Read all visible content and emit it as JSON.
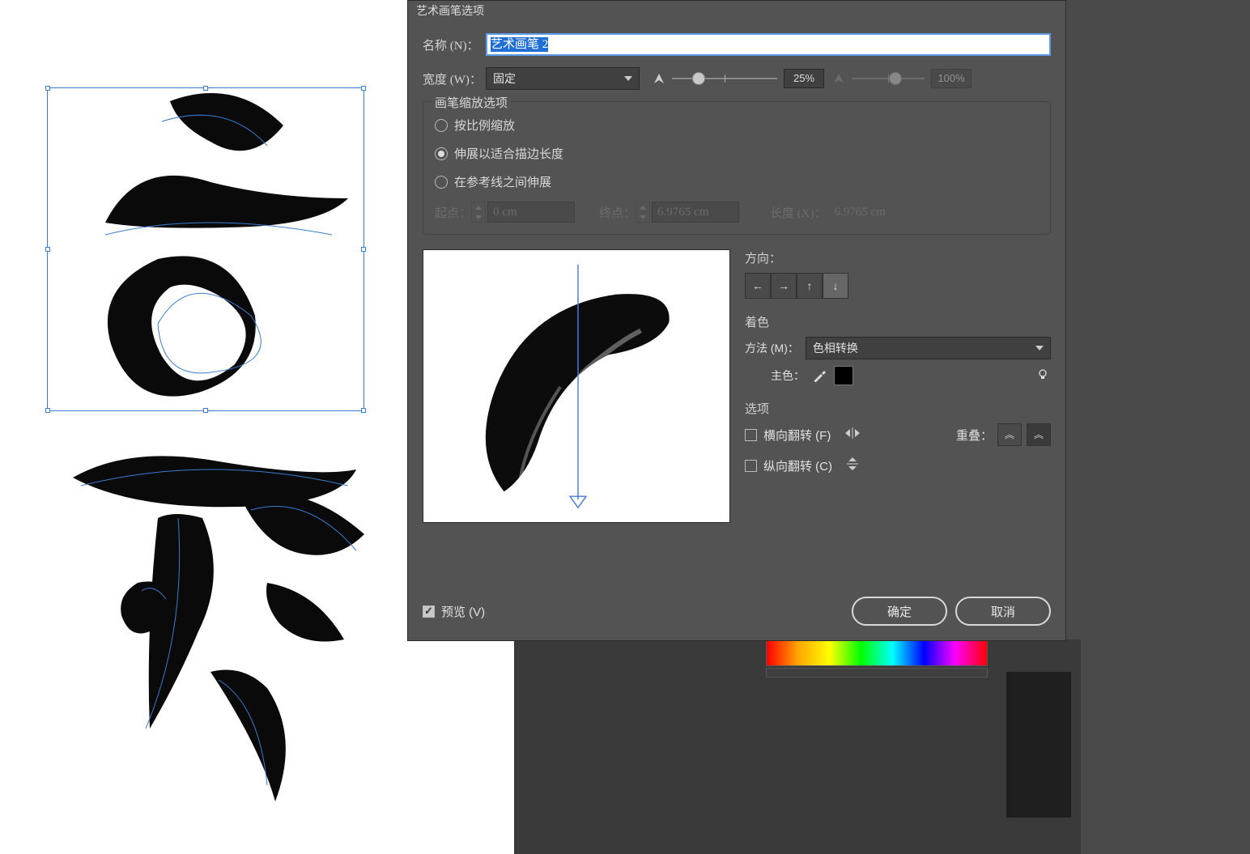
{
  "dialog": {
    "title": "艺术画笔选项",
    "name_label": "名称 (N)：",
    "name_value": "艺术画笔 2",
    "width_label": "宽度 (W)：",
    "width_mode": "固定",
    "width_pct1": "25%",
    "width_pct2": "100%",
    "scale_group_title": "画笔缩放选项",
    "scale_opts": {
      "proportional": "按比例缩放",
      "stretch": "伸展以适合描边长度",
      "between_guides": "在参考线之间伸展"
    },
    "start_label": "起点：",
    "start_value": "0 cm",
    "end_label": "终点：",
    "end_value": "6.9765 cm",
    "length_label": "长度 (X)：",
    "length_value": "6.9765 cm",
    "direction_label": "方向：",
    "colorize_label": "着色",
    "method_label": "方法 (M)：",
    "method_value": "色相转换",
    "keycolor_label": "主色：",
    "options_label": "选项",
    "flip_h": "横向翻转 (F)",
    "flip_v": "纵向翻转 (C)",
    "overlap_label": "重叠：",
    "preview_label": "预览 (V)",
    "ok": "确定",
    "cancel": "取消"
  }
}
